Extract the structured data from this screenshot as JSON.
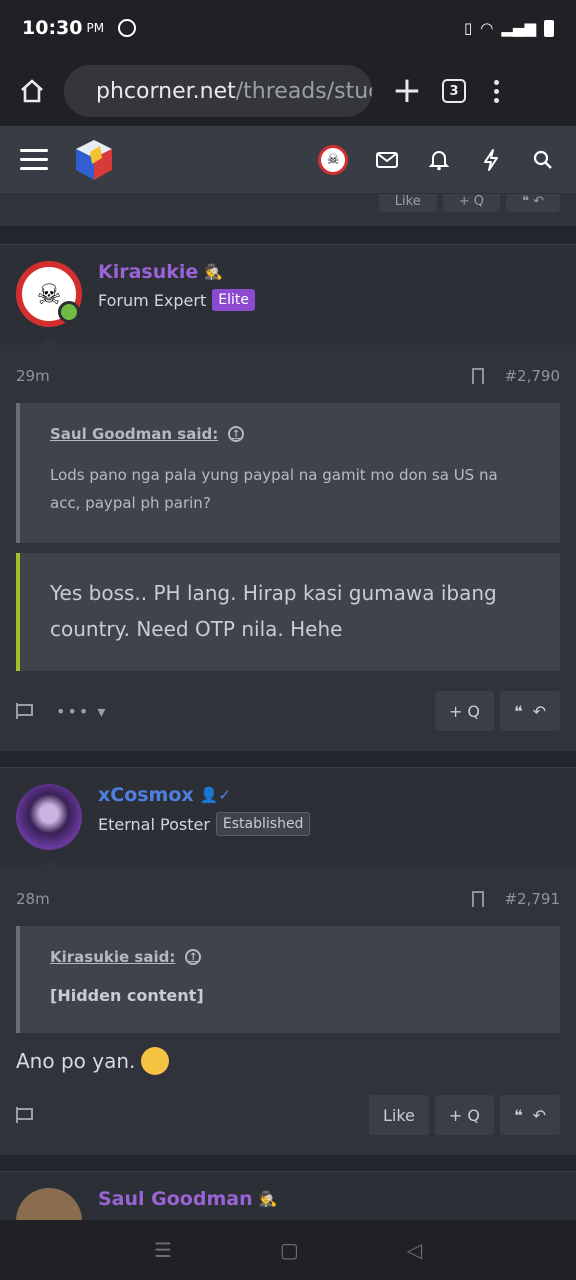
{
  "status": {
    "time": "10:30",
    "ampm": "PM"
  },
  "browser": {
    "url_host": "phcorner.net",
    "url_path": "/threads/stuc",
    "tab_count": "3"
  },
  "prev_post": {
    "like_label": "Like",
    "quote_label": "+ Q"
  },
  "posts": [
    {
      "username": "Kirasukie",
      "user_title": "Forum Expert",
      "badge": "Elite",
      "time": "29m",
      "number": "#2,790",
      "quote_author": "Saul Goodman said:",
      "quote_text": "Lods pano nga pala yung paypal na gamit mo don sa US na acc, paypal ph parin?",
      "reply_text": "Yes boss.. PH lang. Hirap kasi gumawa ibang country. Need OTP nila. Hehe",
      "more_label": "•••",
      "quote_btn": "+ Q"
    },
    {
      "username": "xCosmox",
      "user_title": "Eternal Poster",
      "badge": "Established",
      "time": "28m",
      "number": "#2,791",
      "quote_author": "Kirasukie said:",
      "quote_hidden": "[Hidden content]",
      "body": "Ano po yan.",
      "like_btn": "Like",
      "quote_btn": "+ Q"
    },
    {
      "username": "Saul Goodman"
    }
  ]
}
